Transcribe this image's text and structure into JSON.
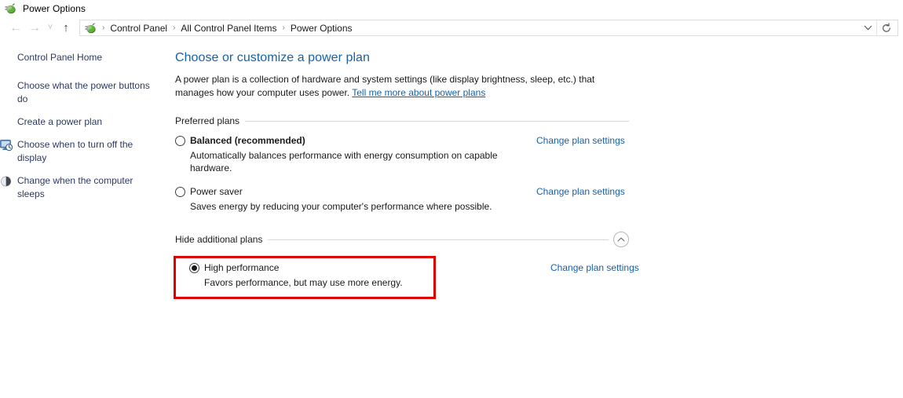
{
  "window": {
    "title": "Power Options",
    "icon": "power-plug-icon"
  },
  "navbar": {
    "back_icon": "back-arrow-icon",
    "forward_icon": "forward-arrow-icon",
    "recent_icon": "recent-locations-chevron-icon",
    "up_icon": "up-arrow-icon",
    "address_icon": "power-plug-icon",
    "breadcrumbs": [
      {
        "label": "Control Panel"
      },
      {
        "label": "All Control Panel Items"
      },
      {
        "label": "Power Options"
      }
    ],
    "separator": "›",
    "dropdown_icon": "chevron-down-icon",
    "refresh_icon": "refresh-icon"
  },
  "sidebar": {
    "items": [
      {
        "label": "Control Panel Home",
        "icon": null
      },
      {
        "label": "Choose what the power buttons do",
        "icon": null
      },
      {
        "label": "Create a power plan",
        "icon": null
      },
      {
        "label": "Choose when to turn off the display",
        "icon": "display-clock-icon"
      },
      {
        "label": "Change when the computer sleeps",
        "icon": "sleep-moon-icon"
      }
    ]
  },
  "main": {
    "title": "Choose or customize a power plan",
    "description_before": "A power plan is a collection of hardware and system settings (like display brightness, sleep, etc.) that manages how your computer uses power. ",
    "description_link": "Tell me more about power plans",
    "sections": [
      {
        "label": "Preferred plans",
        "has_collapse": false,
        "plans": [
          {
            "name": "Balanced (recommended)",
            "bold": true,
            "selected": false,
            "description": "Automatically balances performance with energy consumption on capable hardware.",
            "action": "Change plan settings",
            "highlighted": false
          },
          {
            "name": "Power saver",
            "bold": false,
            "selected": false,
            "description": "Saves energy by reducing your computer's performance where possible.",
            "action": "Change plan settings",
            "highlighted": false
          }
        ]
      },
      {
        "label": "Hide additional plans",
        "has_collapse": true,
        "collapse_icon": "chevron-up-icon",
        "plans": [
          {
            "name": "High performance",
            "bold": false,
            "selected": true,
            "description": "Favors performance, but may use more energy.",
            "action": "Change plan settings",
            "highlighted": true
          }
        ]
      }
    ]
  },
  "colors": {
    "link": "#1761a8",
    "sidebar_link": "#2b3a63",
    "highlight": "#e00000",
    "rule": "#d9d9d7"
  }
}
